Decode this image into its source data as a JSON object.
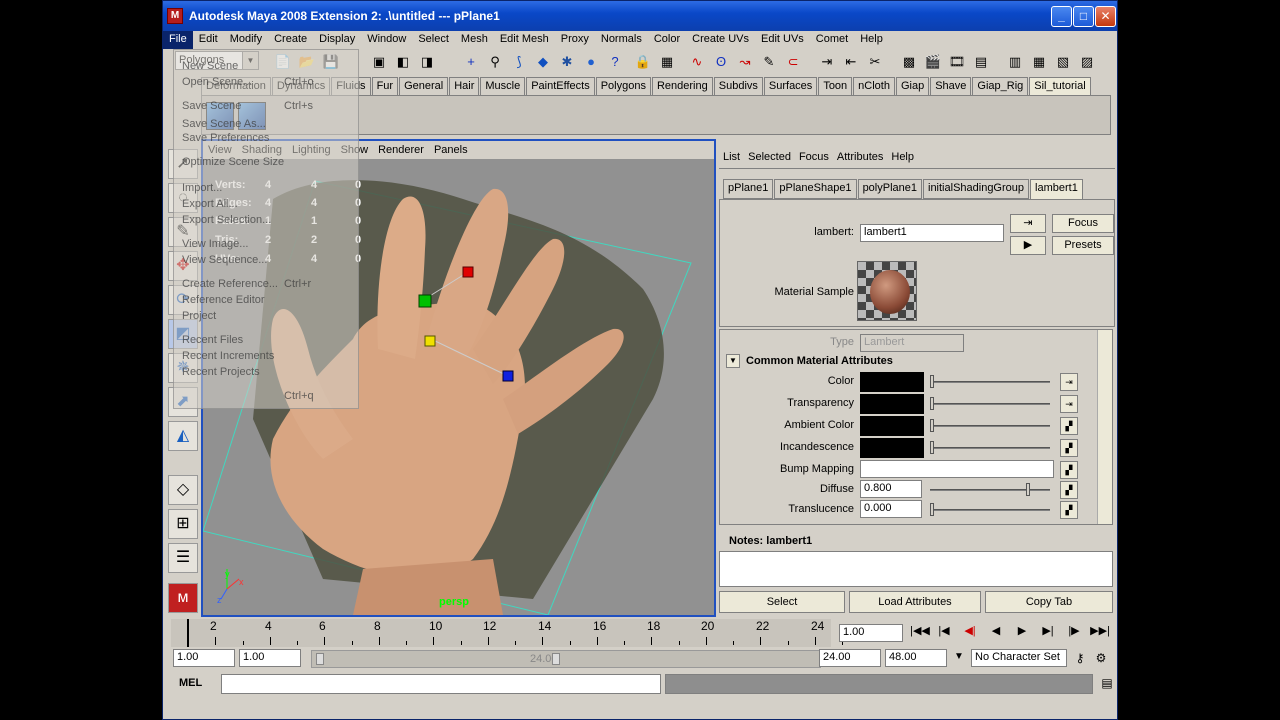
{
  "window": {
    "title": "Autodesk Maya 2008 Extension 2: .\\untitled    ---    pPlane1",
    "app_icon": "maya-icon",
    "buttons": {
      "minimize": "_",
      "maximize": "□",
      "close": "✕"
    }
  },
  "menubar": [
    "File",
    "Edit",
    "Modify",
    "Create",
    "Display",
    "Window",
    "Select",
    "Mesh",
    "Edit Mesh",
    "Proxy",
    "Normals",
    "Color",
    "Create UVs",
    "Edit UVs",
    "Comet",
    "Help"
  ],
  "toolbar": {
    "mode": "Polygons",
    "mode_arrow": "▼"
  },
  "shelf_tabs": [
    "Deformation",
    "Dynamics",
    "Fluids",
    "Fur",
    "General",
    "Hair",
    "Muscle",
    "PaintEffects",
    "Polygons",
    "Rendering",
    "Subdivs",
    "Surfaces",
    "Toon",
    "nCloth",
    "Giap",
    "Shave",
    "Giap_Rig",
    "Sil_tutorial"
  ],
  "file_menu_ghost": {
    "items": [
      {
        "label": "New Scene",
        "shortcut": ""
      },
      {
        "label": "Open Scene...",
        "shortcut": "Ctrl+o"
      },
      {
        "label": "Save Scene",
        "shortcut": "Ctrl+s"
      },
      {
        "label": "Save Scene As...",
        "shortcut": ""
      },
      {
        "label": "Save Preferences",
        "shortcut": ""
      },
      {
        "label": "Optimize Scene Size",
        "shortcut": ""
      },
      {
        "label": "Import...",
        "shortcut": ""
      },
      {
        "label": "Export All...",
        "shortcut": ""
      },
      {
        "label": "Export Selection...",
        "shortcut": ""
      },
      {
        "label": "View Image...",
        "shortcut": ""
      },
      {
        "label": "View Sequence...",
        "shortcut": ""
      },
      {
        "label": "Create Reference...",
        "shortcut": "Ctrl+r"
      },
      {
        "label": "Reference Editor",
        "shortcut": ""
      },
      {
        "label": "Project",
        "shortcut": ""
      },
      {
        "label": "Recent Files",
        "shortcut": ""
      },
      {
        "label": "Recent Increments",
        "shortcut": ""
      },
      {
        "label": "Recent Projects",
        "shortcut": ""
      },
      {
        "label": "",
        "shortcut": "Ctrl+q"
      }
    ]
  },
  "viewport": {
    "menu": [
      "View",
      "Shading",
      "Lighting",
      "Show",
      "Renderer",
      "Panels"
    ],
    "camera_label": "persp",
    "hud": [
      {
        "label": "Verts:",
        "a": "4",
        "b": "4",
        "c": "0"
      },
      {
        "label": "Edges:",
        "a": "4",
        "b": "4",
        "c": "0"
      },
      {
        "label": "Faces:",
        "a": "1",
        "b": "1",
        "c": "0"
      },
      {
        "label": "Tris:",
        "a": "2",
        "b": "2",
        "c": "0"
      },
      {
        "label": "UVs:",
        "a": "4",
        "b": "4",
        "c": "0"
      }
    ],
    "axis_labels": {
      "y": "y",
      "z": "z",
      "x": "x"
    }
  },
  "attribute_editor": {
    "menu": [
      "List",
      "Selected",
      "Focus",
      "Attributes",
      "Help"
    ],
    "tabs": [
      "pPlane1",
      "pPlaneShape1",
      "polyPlane1",
      "initialShadingGroup",
      "lambert1"
    ],
    "node_label": "lambert:",
    "node_name": "lambert1",
    "focus_button": "Focus",
    "presets_button": "Presets",
    "material_sample_label": "Material Sample",
    "type_label": "Type",
    "type_value": "Lambert",
    "section_title": "Common Material Attributes",
    "attributes": [
      {
        "label": "Color",
        "kind": "color",
        "slider": 0.0
      },
      {
        "label": "Transparency",
        "kind": "color",
        "slider": 0.0
      },
      {
        "label": "Ambient Color",
        "kind": "color",
        "slider": 0.0
      },
      {
        "label": "Incandescence",
        "kind": "color",
        "slider": 0.0
      },
      {
        "label": "Bump Mapping",
        "kind": "map"
      },
      {
        "label": "Diffuse",
        "kind": "float",
        "value": "0.800",
        "slider": 0.8
      },
      {
        "label": "Translucence",
        "kind": "float",
        "value": "0.000",
        "slider": 0.0
      }
    ],
    "notes_label": "Notes:  lambert1",
    "buttons": {
      "select": "Select",
      "load": "Load Attributes",
      "copy": "Copy Tab"
    }
  },
  "timeline": {
    "ticks": [
      "2",
      "4",
      "6",
      "8",
      "10",
      "12",
      "14",
      "16",
      "18",
      "20",
      "22",
      "24"
    ],
    "current_frame": "1.00",
    "playback": [
      "|◀◀",
      "|◀",
      "◀|",
      "◀",
      "▶",
      "▶|",
      "|▶",
      "▶▶|"
    ]
  },
  "range": {
    "start": "1.00",
    "playback_start": "1.00",
    "slider_label": "24.00",
    "playback_end": "24.00",
    "end": "48.00",
    "character_set": "No Character Set"
  },
  "command_line": {
    "label": "MEL"
  },
  "colors": {
    "window_bg": "#d4d0c8",
    "title_bar": "#0a48c8",
    "viewport_border": "#2050c0",
    "hud_text": "#ffffff",
    "camera_label": "#00ff00"
  }
}
